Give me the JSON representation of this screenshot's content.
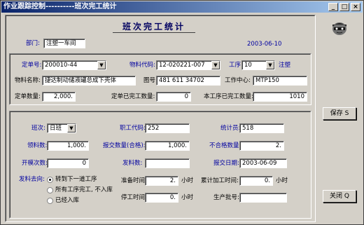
{
  "window": {
    "title": "作业跟踪控制----------班次完工统计",
    "controls": [
      "_",
      "□",
      "×"
    ]
  },
  "form_title": "班次完工统计",
  "header": {
    "dept_label": "部门:",
    "dept_value": "注塑一车间",
    "date": "2003-06-10"
  },
  "order": {
    "order_no_label": "定单号:",
    "order_no": "200010-44",
    "material_code_label": "物料代码:",
    "material_code": "12-020221-007",
    "process_label": "工序:",
    "process": "10",
    "process_name": "注塑",
    "material_name_label": "物料名称:",
    "material_name": "捷达制动储液罐总成下壳体",
    "drawing_label": "图号:",
    "drawing": "481 611 34702",
    "work_center_label": "工作中心:",
    "work_center": "MTP150",
    "order_qty_label": "定单数量:",
    "order_qty": "2,000.",
    "order_done_label": "定单已完工数量:",
    "order_done": "0",
    "process_done_label": "本工序已完工数量:",
    "process_done": "1010"
  },
  "shift": {
    "shift_label": "班次:",
    "shift": "日班",
    "staff_code_label": "职工代码:",
    "staff_code": "252",
    "stat_label": "统计员:",
    "stat": "518",
    "received_label": "领料数:",
    "received": "1,000.",
    "report_qty_label": "报交数量(合格):",
    "report_qty": "1,000.",
    "reject_label": "不合格数量:",
    "reject": "2.",
    "machine_label": "开模次数:",
    "machine": "0",
    "issue_label": "发料数:",
    "issue": "",
    "report_date_label": "报交日期:",
    "report_date": "2003-06-09",
    "dest_label": "发料去向:",
    "dest_options": [
      "转到下一道工序",
      "所有工序完工, 不入库",
      "已经入库"
    ],
    "prep_label": "准备时间:",
    "prep": "2.",
    "hours": "小时",
    "cumulative_label": "累计加工时间:",
    "cumulative": "0.",
    "stop_label": "停工时间:",
    "stop": "0.",
    "batch_label": "生产批号:",
    "batch": ""
  },
  "buttons": {
    "save": "保存 S",
    "close": "关闭 Q"
  }
}
